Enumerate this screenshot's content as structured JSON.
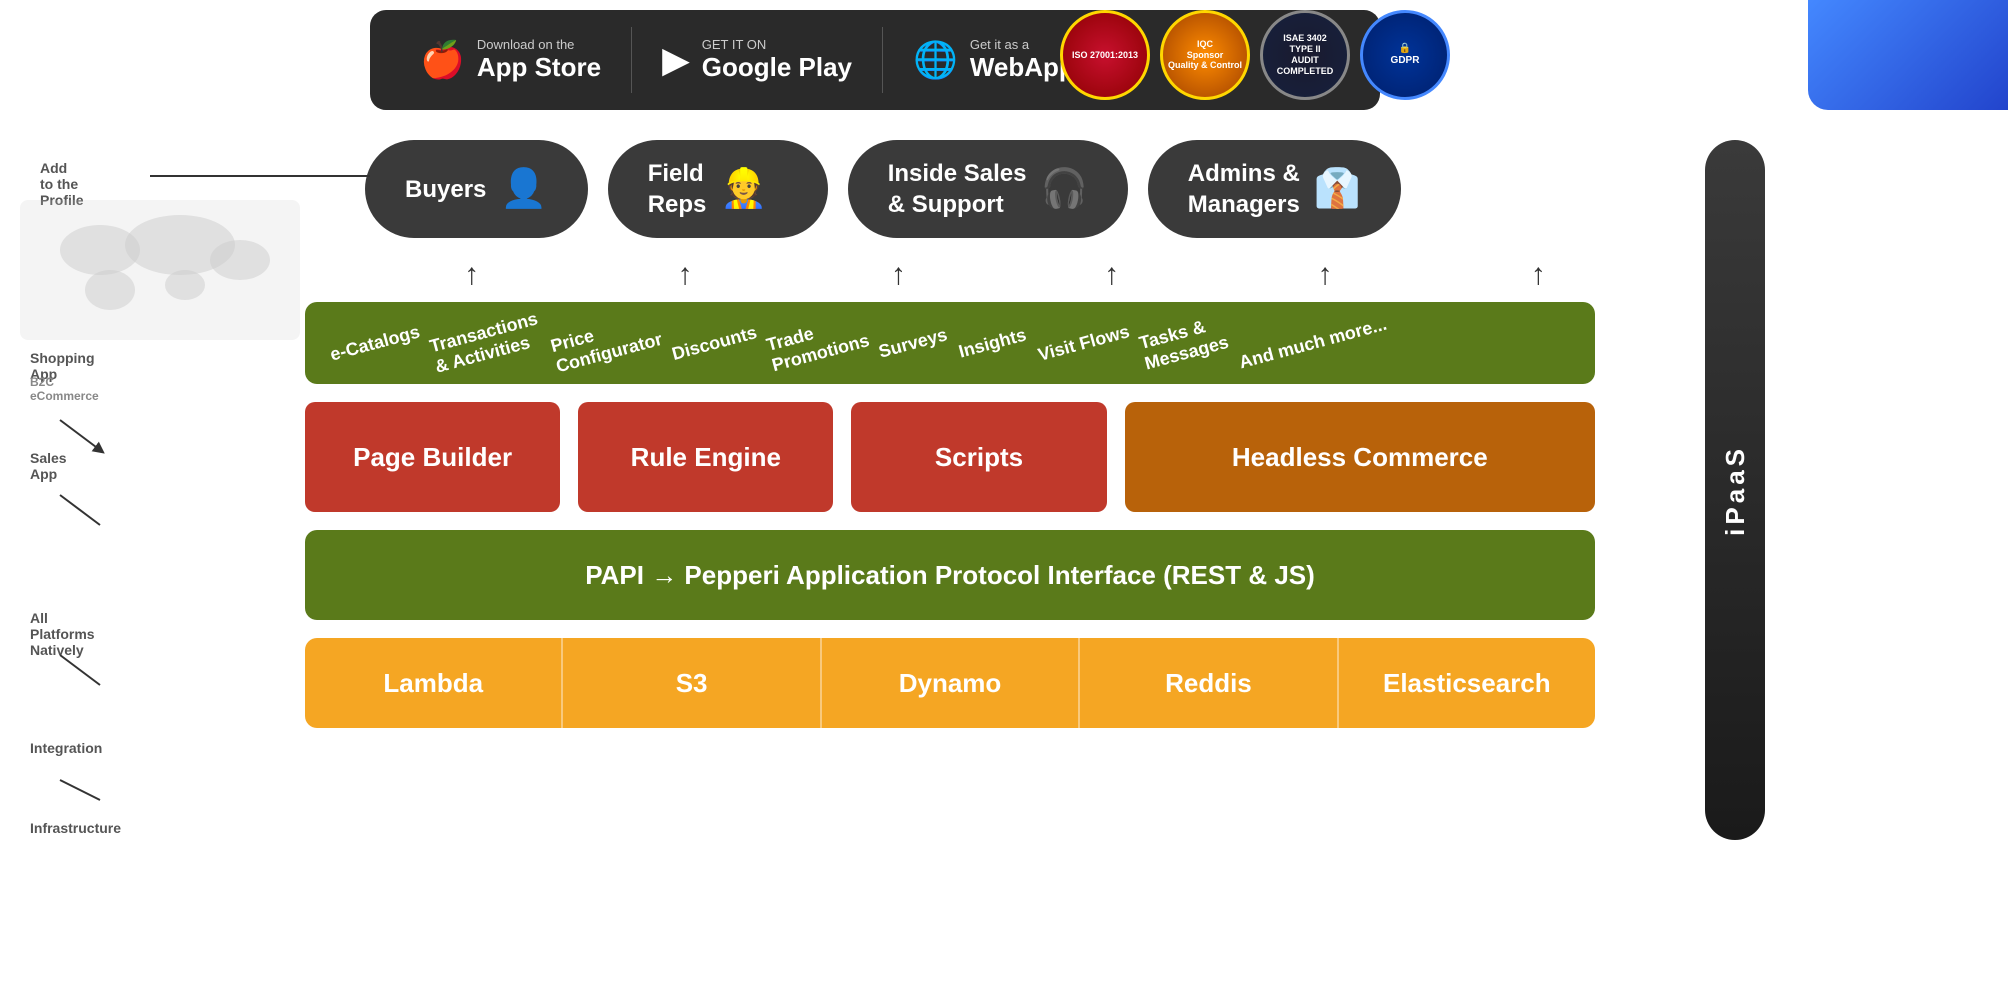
{
  "topbar": {
    "appstore": {
      "small": "Download on the",
      "big": "App Store"
    },
    "googleplay": {
      "small": "GET IT ON",
      "big": "Google Play"
    },
    "webapp": {
      "small": "Get it as a",
      "big": "WebApp"
    }
  },
  "badges": [
    {
      "id": "iso",
      "text": "ISO 27001:2013",
      "color1": "#c8102e",
      "color2": "#8b0000"
    },
    {
      "id": "iqa",
      "text": "IQC\nQuality & Control",
      "color1": "#ff8c00",
      "color2": "#cc6600"
    },
    {
      "id": "isae",
      "text": "ISAE 3402\nTYPE II\nAUDIT COMPLETED",
      "color1": "#1a1a2e",
      "color2": "#16213e"
    },
    {
      "id": "gdpr",
      "text": "GDPR",
      "color1": "#003399",
      "color2": "#001f6b"
    }
  ],
  "personas": [
    {
      "id": "buyers",
      "label": "Buyers",
      "icon": "👤"
    },
    {
      "id": "field-reps",
      "label": "Field\nReps",
      "icon": "👷"
    },
    {
      "id": "inside-sales",
      "label": "Inside Sales\n& Support",
      "icon": "🎧"
    },
    {
      "id": "admins",
      "label": "Admins &\nManagers",
      "icon": "👔"
    }
  ],
  "features": [
    "e-Catalogs",
    "Transactions & Activities",
    "Price Configurator",
    "Discounts",
    "Trade Promotions",
    "Surveys",
    "Insights",
    "Visit Flows",
    "Tasks & Messages",
    "And much more..."
  ],
  "middleRow": [
    {
      "id": "page-builder",
      "label": "Page Builder",
      "type": "red"
    },
    {
      "id": "rule-engine",
      "label": "Rule Engine",
      "type": "red"
    },
    {
      "id": "scripts",
      "label": "Scripts",
      "type": "red"
    },
    {
      "id": "headless-commerce",
      "label": "Headless Commerce",
      "type": "orange"
    }
  ],
  "papi": {
    "text": "PAPI → Pepperi Application Protocol Interface (REST & JS)"
  },
  "lambdaRow": [
    {
      "id": "lambda",
      "label": "Lambda"
    },
    {
      "id": "s3",
      "label": "S3"
    },
    {
      "id": "dynamo",
      "label": "Dynamo"
    },
    {
      "id": "reddis",
      "label": "Reddis"
    },
    {
      "id": "elasticsearch",
      "label": "Elasticsearch"
    }
  ],
  "ipaas": {
    "label": "iPaaS"
  },
  "leftAnnotations": [
    {
      "id": "ann1",
      "text": "Add to the Profile"
    },
    {
      "id": "ann2",
      "text": "Shopping App"
    },
    {
      "id": "ann3",
      "text": "Sales App"
    },
    {
      "id": "ann4",
      "text": "All Platforms Natively"
    },
    {
      "id": "ann5",
      "text": "Integration"
    },
    {
      "id": "ann6",
      "text": "Infrastructure"
    }
  ],
  "arrows": [
    "↑",
    "↑",
    "↑",
    "↑",
    "↑",
    "↑"
  ]
}
